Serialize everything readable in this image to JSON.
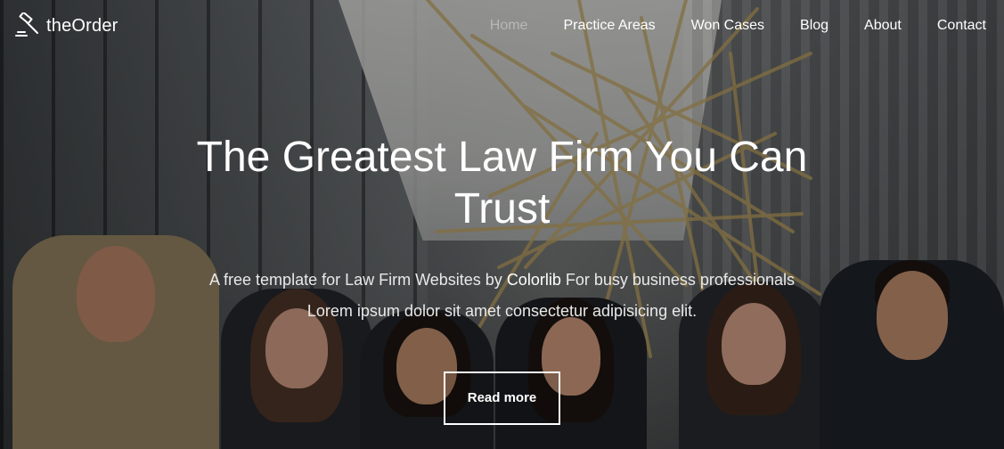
{
  "nav": {
    "brand": "theOrder",
    "brand_icon": "gavel-icon",
    "links": [
      {
        "label": "Home",
        "active": true
      },
      {
        "label": "Practice Areas",
        "active": false
      },
      {
        "label": "Won Cases",
        "active": false
      },
      {
        "label": "Blog",
        "active": false
      },
      {
        "label": "About",
        "active": false
      },
      {
        "label": "Contact",
        "active": false
      }
    ]
  },
  "hero": {
    "title": "The Greatest Law Firm You Can Trust",
    "subtitle_before": "A free template for Law Firm Websites by ",
    "subtitle_link": "Colorlib",
    "subtitle_after": " For busy business professionals Lorem ipsum dolor sit amet consectetur adipisicing elit.",
    "button_label": "Read more"
  },
  "colors": {
    "nav_active": "#b6b8bb",
    "text": "#ffffff"
  }
}
